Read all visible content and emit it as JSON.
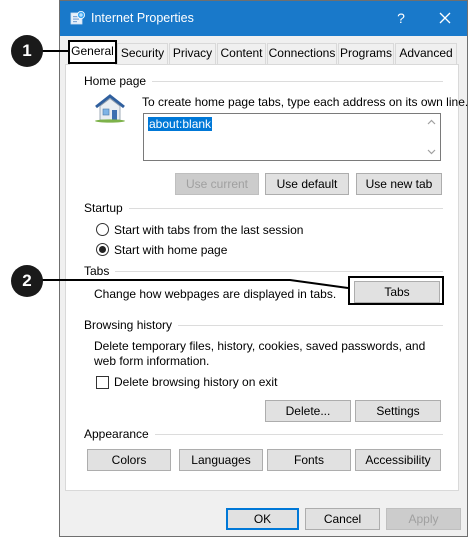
{
  "window": {
    "title": "Internet Properties",
    "help_glyph": "?"
  },
  "tabs": [
    {
      "label": "General",
      "active": true
    },
    {
      "label": "Security"
    },
    {
      "label": "Privacy"
    },
    {
      "label": "Content"
    },
    {
      "label": "Connections"
    },
    {
      "label": "Programs"
    },
    {
      "label": "Advanced"
    }
  ],
  "home_page": {
    "heading": "Home page",
    "instruction": "To create home page tabs, type each address on its own line.",
    "value": "about:blank",
    "buttons": {
      "use_current": "Use current",
      "use_default": "Use default",
      "use_new_tab": "Use new tab"
    }
  },
  "startup": {
    "heading": "Startup",
    "option_last_session": "Start with tabs from the last session",
    "option_home_page": "Start with home page",
    "selected": "home_page"
  },
  "tabs_group": {
    "heading": "Tabs",
    "description": "Change how webpages are displayed in tabs.",
    "button": "Tabs"
  },
  "browsing_history": {
    "heading": "Browsing history",
    "description": "Delete temporary files, history, cookies, saved passwords, and web form information.",
    "checkbox_label": "Delete browsing history on exit",
    "checkbox_checked": false,
    "delete_button": "Delete...",
    "settings_button": "Settings"
  },
  "appearance": {
    "heading": "Appearance",
    "buttons": {
      "colors": "Colors",
      "languages": "Languages",
      "fonts": "Fonts",
      "accessibility": "Accessibility"
    }
  },
  "footer": {
    "ok": "OK",
    "cancel": "Cancel",
    "apply": "Apply"
  },
  "callouts": {
    "first": "1",
    "second": "2"
  },
  "colors": {
    "titlebar": "#1979ca",
    "selection": "#0078d7",
    "callout": "#1a1a1a"
  }
}
